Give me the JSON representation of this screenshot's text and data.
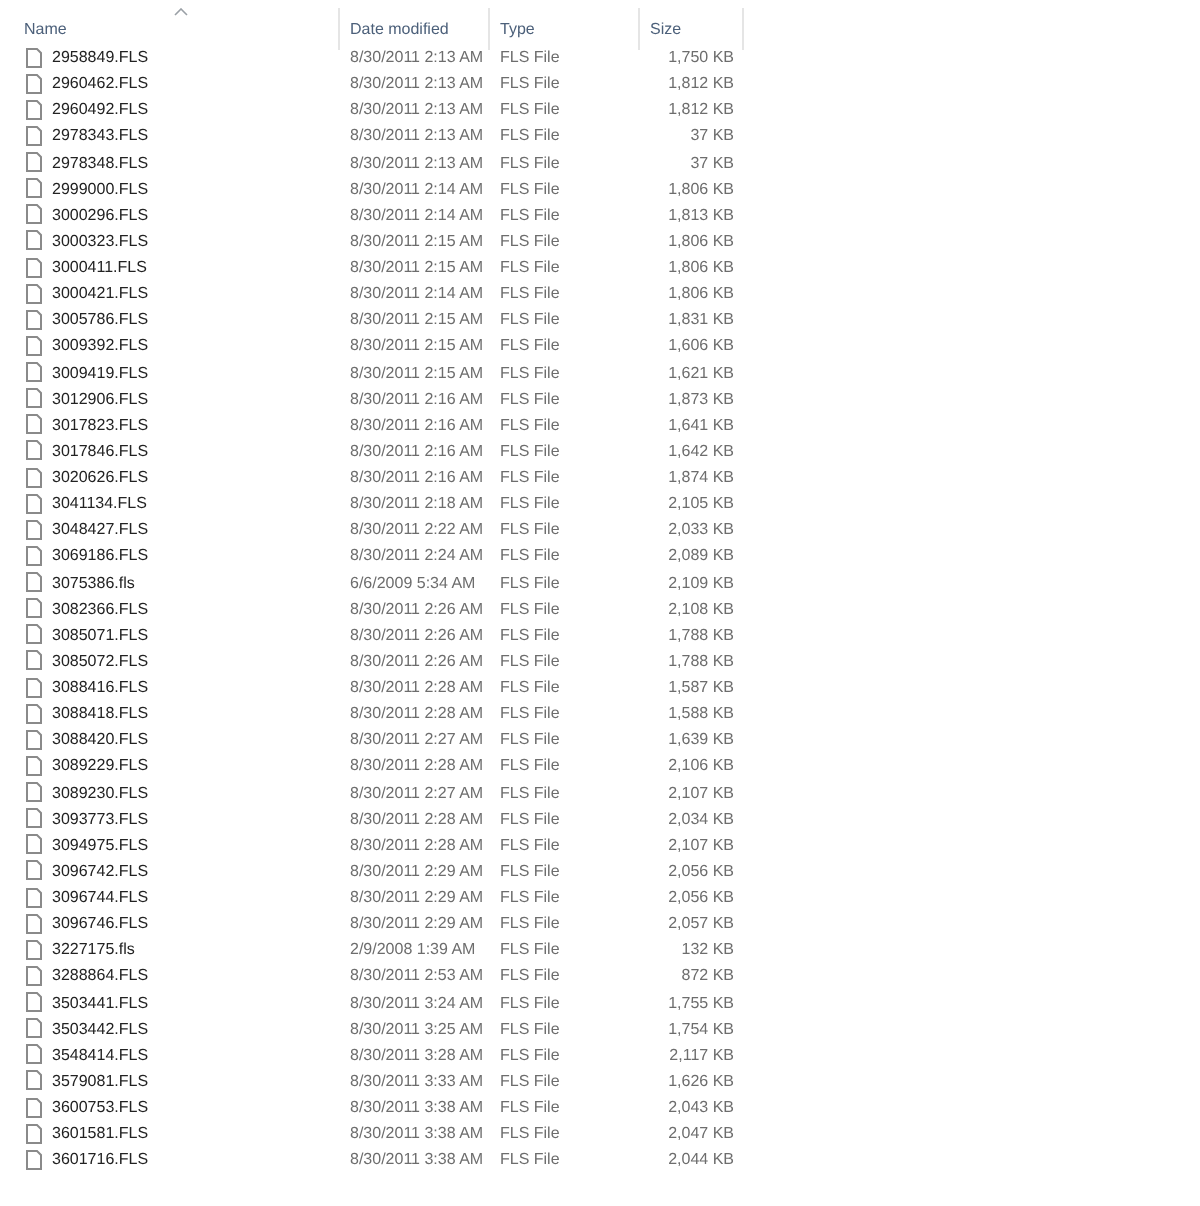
{
  "columns": [
    "Name",
    "Date modified",
    "Type",
    "Size"
  ],
  "rows": [
    {
      "name": "2958849.FLS",
      "date": "8/30/2011 2:13 AM",
      "type": "FLS File",
      "size": "1,750 KB"
    },
    {
      "name": "2960462.FLS",
      "date": "8/30/2011 2:13 AM",
      "type": "FLS File",
      "size": "1,812 KB"
    },
    {
      "name": "2960492.FLS",
      "date": "8/30/2011 2:13 AM",
      "type": "FLS File",
      "size": "1,812 KB"
    },
    {
      "name": "2978343.FLS",
      "date": "8/30/2011 2:13 AM",
      "type": "FLS File",
      "size": "37 KB"
    },
    {
      "name": "2978348.FLS",
      "date": "8/30/2011 2:13 AM",
      "type": "FLS File",
      "size": "37 KB"
    },
    {
      "name": "2999000.FLS",
      "date": "8/30/2011 2:14 AM",
      "type": "FLS File",
      "size": "1,806 KB"
    },
    {
      "name": "3000296.FLS",
      "date": "8/30/2011 2:14 AM",
      "type": "FLS File",
      "size": "1,813 KB"
    },
    {
      "name": "3000323.FLS",
      "date": "8/30/2011 2:15 AM",
      "type": "FLS File",
      "size": "1,806 KB"
    },
    {
      "name": "3000411.FLS",
      "date": "8/30/2011 2:15 AM",
      "type": "FLS File",
      "size": "1,806 KB"
    },
    {
      "name": "3000421.FLS",
      "date": "8/30/2011 2:14 AM",
      "type": "FLS File",
      "size": "1,806 KB"
    },
    {
      "name": "3005786.FLS",
      "date": "8/30/2011 2:15 AM",
      "type": "FLS File",
      "size": "1,831 KB"
    },
    {
      "name": "3009392.FLS",
      "date": "8/30/2011 2:15 AM",
      "type": "FLS File",
      "size": "1,606 KB"
    },
    {
      "name": "3009419.FLS",
      "date": "8/30/2011 2:15 AM",
      "type": "FLS File",
      "size": "1,621 KB"
    },
    {
      "name": "3012906.FLS",
      "date": "8/30/2011 2:16 AM",
      "type": "FLS File",
      "size": "1,873 KB"
    },
    {
      "name": "3017823.FLS",
      "date": "8/30/2011 2:16 AM",
      "type": "FLS File",
      "size": "1,641 KB"
    },
    {
      "name": "3017846.FLS",
      "date": "8/30/2011 2:16 AM",
      "type": "FLS File",
      "size": "1,642 KB"
    },
    {
      "name": "3020626.FLS",
      "date": "8/30/2011 2:16 AM",
      "type": "FLS File",
      "size": "1,874 KB"
    },
    {
      "name": "3041134.FLS",
      "date": "8/30/2011 2:18 AM",
      "type": "FLS File",
      "size": "2,105 KB"
    },
    {
      "name": "3048427.FLS",
      "date": "8/30/2011 2:22 AM",
      "type": "FLS File",
      "size": "2,033 KB"
    },
    {
      "name": "3069186.FLS",
      "date": "8/30/2011 2:24 AM",
      "type": "FLS File",
      "size": "2,089 KB"
    },
    {
      "name": "3075386.fls",
      "date": "6/6/2009 5:34 AM",
      "type": "FLS File",
      "size": "2,109 KB"
    },
    {
      "name": "3082366.FLS",
      "date": "8/30/2011 2:26 AM",
      "type": "FLS File",
      "size": "2,108 KB"
    },
    {
      "name": "3085071.FLS",
      "date": "8/30/2011 2:26 AM",
      "type": "FLS File",
      "size": "1,788 KB"
    },
    {
      "name": "3085072.FLS",
      "date": "8/30/2011 2:26 AM",
      "type": "FLS File",
      "size": "1,788 KB"
    },
    {
      "name": "3088416.FLS",
      "date": "8/30/2011 2:28 AM",
      "type": "FLS File",
      "size": "1,587 KB"
    },
    {
      "name": "3088418.FLS",
      "date": "8/30/2011 2:28 AM",
      "type": "FLS File",
      "size": "1,588 KB"
    },
    {
      "name": "3088420.FLS",
      "date": "8/30/2011 2:27 AM",
      "type": "FLS File",
      "size": "1,639 KB"
    },
    {
      "name": "3089229.FLS",
      "date": "8/30/2011 2:28 AM",
      "type": "FLS File",
      "size": "2,106 KB"
    },
    {
      "name": "3089230.FLS",
      "date": "8/30/2011 2:27 AM",
      "type": "FLS File",
      "size": "2,107 KB"
    },
    {
      "name": "3093773.FLS",
      "date": "8/30/2011 2:28 AM",
      "type": "FLS File",
      "size": "2,034 KB"
    },
    {
      "name": "3094975.FLS",
      "date": "8/30/2011 2:28 AM",
      "type": "FLS File",
      "size": "2,107 KB"
    },
    {
      "name": "3096742.FLS",
      "date": "8/30/2011 2:29 AM",
      "type": "FLS File",
      "size": "2,056 KB"
    },
    {
      "name": "3096744.FLS",
      "date": "8/30/2011 2:29 AM",
      "type": "FLS File",
      "size": "2,056 KB"
    },
    {
      "name": "3096746.FLS",
      "date": "8/30/2011 2:29 AM",
      "type": "FLS File",
      "size": "2,057 KB"
    },
    {
      "name": "3227175.fls",
      "date": "2/9/2008 1:39 AM",
      "type": "FLS File",
      "size": "132 KB"
    },
    {
      "name": "3288864.FLS",
      "date": "8/30/2011 2:53 AM",
      "type": "FLS File",
      "size": "872 KB"
    },
    {
      "name": "3503441.FLS",
      "date": "8/30/2011 3:24 AM",
      "type": "FLS File",
      "size": "1,755 KB"
    },
    {
      "name": "3503442.FLS",
      "date": "8/30/2011 3:25 AM",
      "type": "FLS File",
      "size": "1,754 KB"
    },
    {
      "name": "3548414.FLS",
      "date": "8/30/2011 3:28 AM",
      "type": "FLS File",
      "size": "2,117 KB"
    },
    {
      "name": "3579081.FLS",
      "date": "8/30/2011 3:33 AM",
      "type": "FLS File",
      "size": "1,626 KB"
    },
    {
      "name": "3600753.FLS",
      "date": "8/30/2011 3:38 AM",
      "type": "FLS File",
      "size": "2,043 KB"
    },
    {
      "name": "3601581.FLS",
      "date": "8/30/2011 3:38 AM",
      "type": "FLS File",
      "size": "2,047 KB"
    },
    {
      "name": "3601716.FLS",
      "date": "8/30/2011 3:38 AM",
      "type": "FLS File",
      "size": "2,044 KB"
    }
  ]
}
